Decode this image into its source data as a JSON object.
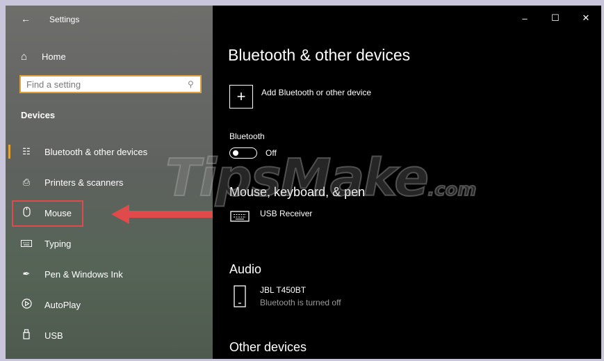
{
  "window": {
    "title": "Settings",
    "controls": [
      "–",
      "☐",
      "✕"
    ]
  },
  "sidebar": {
    "home_label": "Home",
    "search_placeholder": "Find a setting",
    "section_label": "Devices",
    "items": [
      {
        "label": "Bluetooth & other devices",
        "icon": "bluetooth-devices-icon",
        "selected": true
      },
      {
        "label": "Printers & scanners",
        "icon": "printer-icon"
      },
      {
        "label": "Mouse",
        "icon": "mouse-icon",
        "highlighted": true
      },
      {
        "label": "Typing",
        "icon": "keyboard-icon"
      },
      {
        "label": "Pen & Windows Ink",
        "icon": "pen-icon"
      },
      {
        "label": "AutoPlay",
        "icon": "autoplay-icon"
      },
      {
        "label": "USB",
        "icon": "usb-icon"
      }
    ]
  },
  "main": {
    "title": "Bluetooth & other devices",
    "add_device_label": "Add Bluetooth or other device",
    "bluetooth_label": "Bluetooth",
    "bluetooth_state": "Off",
    "sections": [
      {
        "title": "Mouse, keyboard, & pen",
        "devices": [
          {
            "name": "USB Receiver",
            "status": "",
            "icon": "keyboard-icon"
          }
        ]
      },
      {
        "title": "Audio",
        "devices": [
          {
            "name": "JBL T450BT",
            "status": "Bluetooth is turned off",
            "icon": "phone-device-icon"
          }
        ]
      },
      {
        "title": "Other devices",
        "devices": []
      }
    ]
  },
  "watermark": {
    "text": "TipsMake",
    "suffix": ".com"
  },
  "colors": {
    "accent": "#e1a23b",
    "annotation": "#e04a4a"
  }
}
